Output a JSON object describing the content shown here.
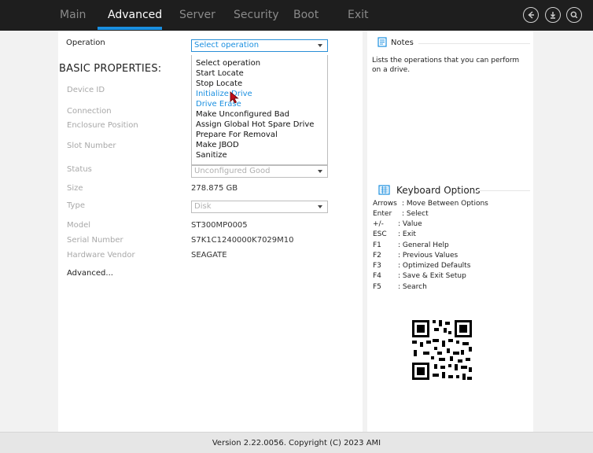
{
  "nav": {
    "tabs": [
      {
        "label": "Main"
      },
      {
        "label": "Advanced"
      },
      {
        "label": "Server"
      },
      {
        "label": "Security"
      },
      {
        "label": "Boot"
      },
      {
        "label": "Exit"
      }
    ],
    "active_tab": "Advanced",
    "controls": [
      "back-icon",
      "save-icon",
      "search-icon"
    ]
  },
  "operation": {
    "label": "Operation",
    "selected": "Select operation",
    "options": [
      "Select operation",
      "Start Locate",
      "Stop Locate",
      "Initialize Drive",
      "Drive Erase",
      "Make Unconfigured Bad",
      "Assign Global Hot Spare Drive",
      "Prepare For Removal",
      "Make JBOD",
      "Sanitize"
    ],
    "highlighted": [
      "Initialize Drive",
      "Drive Erase"
    ]
  },
  "properties": {
    "heading": "BASIC PROPERTIES:",
    "device_id_label": "Device ID",
    "connection_label": "Connection",
    "enclosure_position_label": "Enclosure Position",
    "slot_number_label": "Slot Number",
    "status_label": "Status",
    "status_value": "Unconfigured Good",
    "size_label": "Size",
    "size_value": "278.875 GB",
    "type_label": "Type",
    "type_value": "Disk",
    "model_label": "Model",
    "model_value": "ST300MP0005",
    "serial_label": "Serial Number",
    "serial_value": "S7K1C1240000K7029M10",
    "vendor_label": "Hardware Vendor",
    "vendor_value": "SEAGATE",
    "advanced_link": "Advanced..."
  },
  "notes": {
    "title": "Notes",
    "text": "Lists the operations that you can perform on a drive."
  },
  "keyboard": {
    "title": "Keyboard Options",
    "rows": [
      {
        "key": "Arrows",
        "desc": ": Move Between Options"
      },
      {
        "key": "Enter",
        "desc": ": Select"
      },
      {
        "key": "+/-",
        "desc": ": Value"
      },
      {
        "key": "ESC",
        "desc": ": Exit"
      },
      {
        "key": "F1",
        "desc": ": General Help"
      },
      {
        "key": "F2",
        "desc": ": Previous Values"
      },
      {
        "key": "F3",
        "desc": ": Optimized Defaults"
      },
      {
        "key": "F4",
        "desc": ": Save & Exit Setup"
      },
      {
        "key": "F5",
        "desc": ": Search"
      }
    ]
  },
  "footer": {
    "text": "Version 2.22.0056. Copyright (C) 2023 AMI"
  },
  "colors": {
    "accent": "#1a8fe0",
    "topbar": "#1e1e1e"
  }
}
